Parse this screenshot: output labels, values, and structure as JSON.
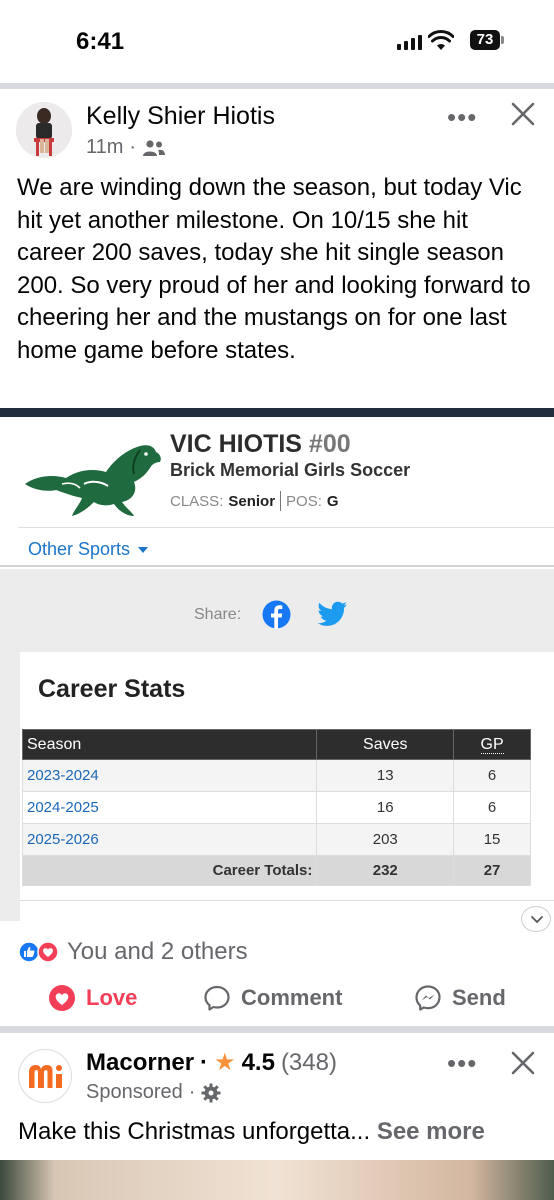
{
  "status_bar": {
    "time": "6:41",
    "battery": "73"
  },
  "post": {
    "author": "Kelly Shier Hiotis",
    "time_ago": "11m",
    "separator": "·",
    "text": "We are winding down the season, but today Vic hit yet another milestone.  On 10/15 she hit career 200 saves, today she hit single season 200. So very proud of her and looking forward to cheering her and the mustangs on for one last home game before states.",
    "more_label": "•••"
  },
  "athlete": {
    "name": "VIC HIOTIS",
    "number": "#00",
    "team": "Brick Memorial Girls Soccer",
    "class_label": "CLASS:",
    "class_value": "Senior",
    "pos_label": "POS:",
    "pos_value": "G",
    "other_sports": "Other Sports",
    "share_label": "Share:"
  },
  "career_stats": {
    "title": "Career Stats",
    "headers": [
      "Season",
      "Saves",
      "GP"
    ],
    "rows": [
      {
        "season": "2023-2024",
        "saves": "13",
        "gp": "6"
      },
      {
        "season": "2024-2025",
        "saves": "16",
        "gp": "6"
      },
      {
        "season": "2025-2026",
        "saves": "203",
        "gp": "15"
      }
    ],
    "totals": {
      "label": "Career Totals:",
      "saves": "232",
      "gp": "27"
    }
  },
  "reactions": {
    "summary": "You and 2 others",
    "love": "Love",
    "comment": "Comment",
    "send": "Send"
  },
  "ad": {
    "name": "Macorner",
    "separator": "·",
    "rating": "4.5",
    "rating_count": "(348)",
    "sponsored": "Sponsored",
    "text": "Make this Christmas unforgetta...",
    "see_more": "See more",
    "more_label": "•••"
  },
  "colors": {
    "link": "#1c68b6",
    "love": "#f33e58",
    "mustang_green": "#1f6b3f",
    "navy": "#1e2c3c",
    "ad_orange": "#f26b21"
  }
}
